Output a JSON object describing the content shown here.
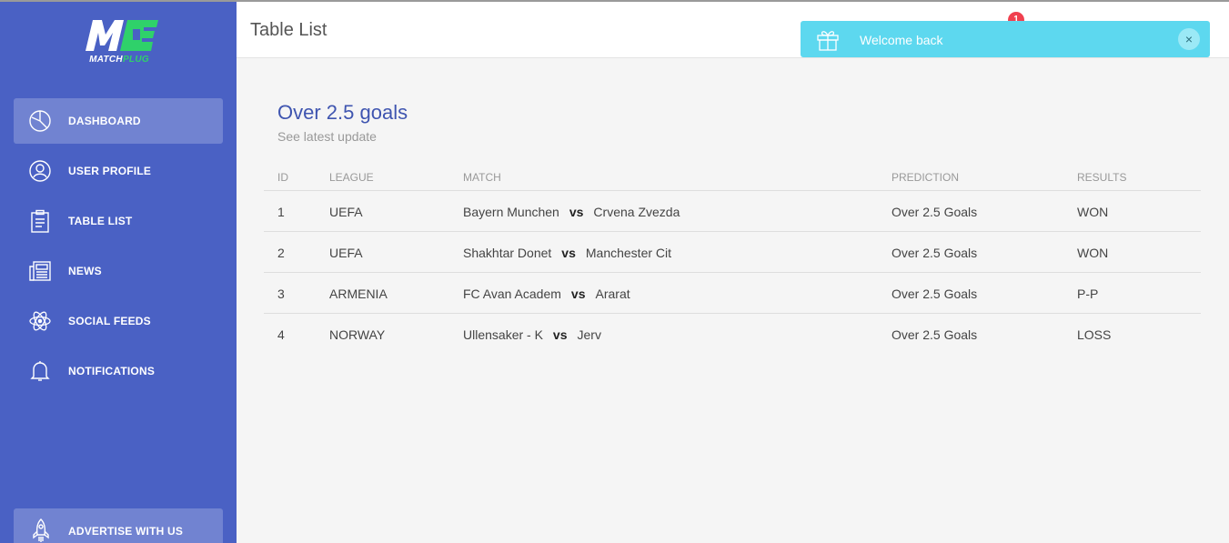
{
  "brand": {
    "name_a": "MATCH",
    "name_b": "PLUG",
    "logo_colors": {
      "white": "#ffffff",
      "green": "#2fd16a"
    }
  },
  "sidebar": {
    "background": "#4a61c4",
    "items": [
      {
        "label": "DASHBOARD",
        "icon": "pie-chart-icon",
        "active": true
      },
      {
        "label": "USER PROFILE",
        "icon": "user-icon"
      },
      {
        "label": "TABLE LIST",
        "icon": "clipboard-icon"
      },
      {
        "label": "NEWS",
        "icon": "newspaper-icon"
      },
      {
        "label": "SOCIAL FEEDS",
        "icon": "atom-icon"
      },
      {
        "label": "NOTIFICATIONS",
        "icon": "bell-icon"
      }
    ],
    "advertise": {
      "label": "ADVERTISE WITH US",
      "icon": "rocket-icon"
    }
  },
  "header": {
    "title": "Table List",
    "notification_count": "1"
  },
  "toast": {
    "message": "Welcome back",
    "icon": "gift-icon",
    "close": "×",
    "color": "#5dd8ef"
  },
  "card": {
    "title": "Over 2.5 goals",
    "subtitle": "See latest update"
  },
  "table": {
    "columns": [
      "ID",
      "LEAGUE",
      "MATCH",
      "PREDICTION",
      "RESULTS"
    ],
    "rows": [
      {
        "id": "1",
        "league": "UEFA",
        "home": "Bayern Munchen",
        "vs": "vs",
        "away": "Crvena Zvezda",
        "prediction": "Over 2.5 Goals",
        "result": "WON"
      },
      {
        "id": "2",
        "league": "UEFA",
        "home": "Shakhtar Donet",
        "vs": "vs",
        "away": "Manchester Cit",
        "prediction": "Over 2.5 Goals",
        "result": "WON"
      },
      {
        "id": "3",
        "league": "ARMENIA",
        "home": "FC Avan Academ",
        "vs": "vs",
        "away": "Ararat",
        "prediction": "Over 2.5 Goals",
        "result": "P-P"
      },
      {
        "id": "4",
        "league": "NORWAY",
        "home": "Ullensaker - K",
        "vs": "vs",
        "away": "Jerv",
        "prediction": "Over 2.5 Goals",
        "result": "LOSS"
      }
    ]
  }
}
